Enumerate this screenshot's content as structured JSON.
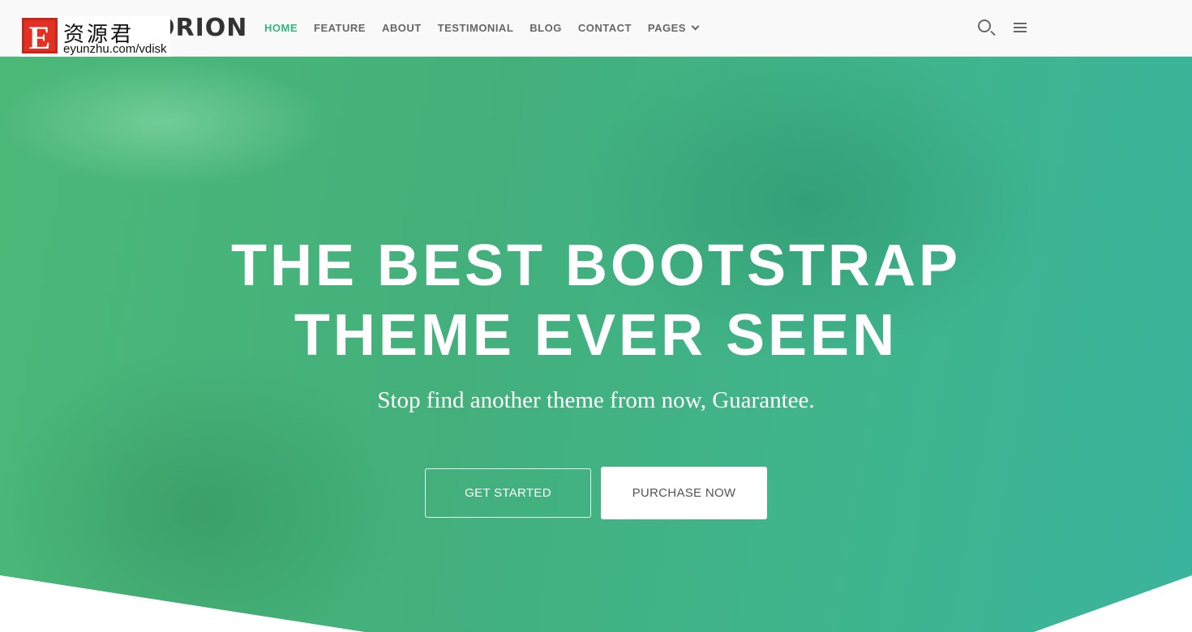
{
  "watermark": {
    "letter": "E",
    "chinese": "资源君",
    "url": "eyunzhu.com/vdisk"
  },
  "logo": "ORION",
  "nav": {
    "items": [
      "HOME",
      "FEATURE",
      "ABOUT",
      "TESTIMONIAL",
      "BLOG",
      "CONTACT",
      "PAGES"
    ],
    "active": "HOME",
    "icons": [
      "search-icon",
      "menu-icon"
    ]
  },
  "hero": {
    "title_line1": "THE BEST BOOTSTRAP",
    "title_line2": "THEME EVER SEEN",
    "subtitle": "Stop find another theme from now, Guarantee.",
    "primary_button": "GET STARTED",
    "secondary_button": "PURCHASE NOW"
  },
  "colors": {
    "accent": "#2fb880"
  }
}
